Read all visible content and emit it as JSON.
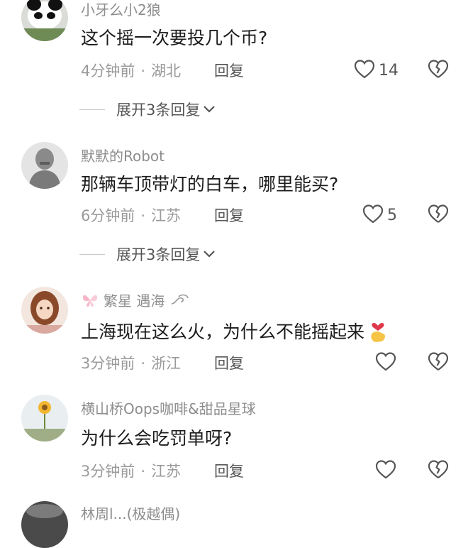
{
  "comments": [
    {
      "username": "小牙么小2狼",
      "text": "这个摇一次要投几个币?",
      "time": "4分钟前",
      "location": "湖北",
      "reply_label": "回复",
      "likes": "14",
      "expand_label": "展开3条回复"
    },
    {
      "username": "默默的Robot",
      "text": "那辆车顶带灯的白车，哪里能买?",
      "time": "6分钟前",
      "location": "江苏",
      "reply_label": "回复",
      "likes": "5",
      "expand_label": "展开3条回复"
    },
    {
      "username": "繁星  遇海",
      "text": "上海现在这么火，为什么不能摇起来",
      "time": "3分钟前",
      "location": "浙江",
      "reply_label": "回复",
      "likes": ""
    },
    {
      "username": "横山桥Oops咖啡&甜品星球",
      "text": "为什么会吃罚单呀?",
      "time": "3分钟前",
      "location": "江苏",
      "reply_label": "回复",
      "likes": ""
    },
    {
      "username": "林周l...(极越偶)",
      "text": ""
    }
  ],
  "icons": {
    "like": "heart-outline-icon",
    "dislike": "broken-heart-icon",
    "expand": "chevron-down-icon"
  },
  "colors": {
    "text": "#1c1c1c",
    "meta": "#9a9a9a",
    "username": "#8d8d8d"
  }
}
